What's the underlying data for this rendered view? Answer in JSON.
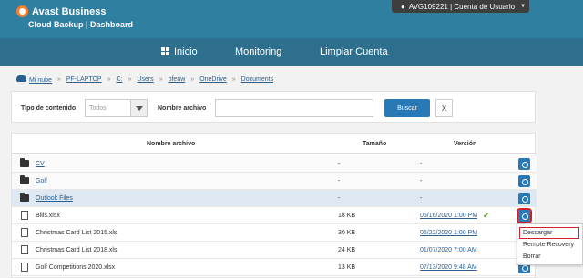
{
  "header": {
    "brand": "Avast Business",
    "subtitle": "Cloud Backup | Dashboard",
    "account": "AVG109221 | Cuenta de Usuario"
  },
  "nav": {
    "inicio": "Inicio",
    "monitoring": "Monitoring",
    "limpiar": "Limpiar Cuenta"
  },
  "breadcrumb": [
    "Mi nube",
    "PF-LAPTOP",
    "C:",
    "Users",
    "pfenw",
    "OneDrive",
    "Documents"
  ],
  "filters": {
    "tipo_label": "Tipo de contenido",
    "tipo_value": "Todos",
    "nombre_label": "Nombre archivo",
    "search_button": "Buscar",
    "clear_button": "X"
  },
  "table": {
    "headers": {
      "name": "Nombre archivo",
      "size": "Tamaño",
      "version": "Versión"
    },
    "rows": [
      {
        "type": "folder",
        "name": "CV",
        "size": "-",
        "version": "-"
      },
      {
        "type": "folder",
        "name": "Golf",
        "size": "-",
        "version": "-"
      },
      {
        "type": "folder",
        "name": "Outlook Files",
        "size": "-",
        "version": "-"
      },
      {
        "type": "file",
        "name": "Bills.xlsx",
        "size": "18 KB",
        "version": "06/16/2020 1:00 PM"
      },
      {
        "type": "file",
        "name": "Christmas Card List 2015.xls",
        "size": "30 KB",
        "version": "06/22/2020 1:00 PM"
      },
      {
        "type": "file",
        "name": "Christmas Card List 2018.xls",
        "size": "24 KB",
        "version": "01/07/2020 7:00 AM"
      },
      {
        "type": "file",
        "name": "Golf Competitions 2020.xlsx",
        "size": "13 KB",
        "version": "07/13/2020 9:48 AM"
      }
    ]
  },
  "menu": {
    "download": "Descargar",
    "restore": "Remote Recovery",
    "delete": "Borrar"
  },
  "colors": {
    "header": "#2f7fa0",
    "nav": "#2f6f8e",
    "accent": "#2a79b7",
    "highlight": "#d0202a"
  }
}
